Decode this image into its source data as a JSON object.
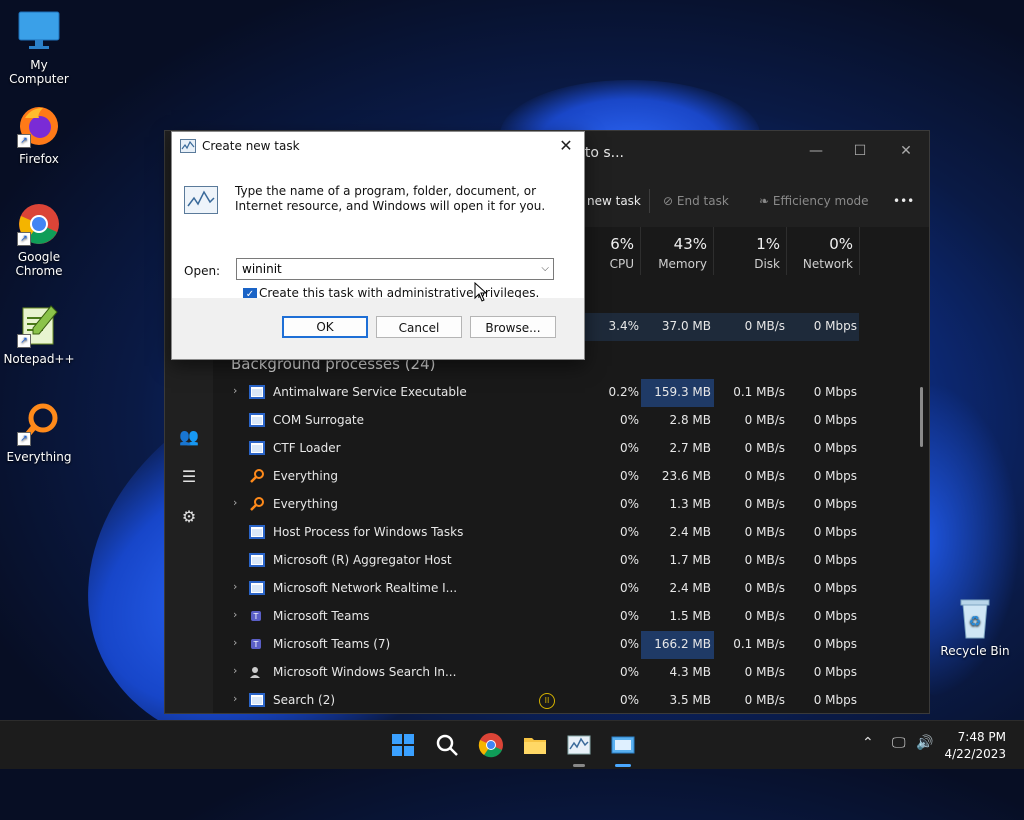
{
  "desktop": {
    "icons": [
      {
        "label": "My Computer",
        "icon": "monitor-icon"
      },
      {
        "label": "Firefox",
        "icon": "firefox-icon"
      },
      {
        "label": "Google Chrome",
        "icon": "chrome-icon"
      },
      {
        "label": "Notepad++",
        "icon": "notepadpp-icon"
      },
      {
        "label": "Everything",
        "icon": "everything-icon"
      },
      {
        "label": "Recycle Bin",
        "icon": "recycle-bin-icon"
      }
    ]
  },
  "task_manager": {
    "search_placeholder": "er, or PID to s...",
    "toolbar": {
      "new_task": "new task",
      "end_task": "End task",
      "efficiency_mode": "Efficiency mode",
      "more": "•••"
    },
    "columns": [
      {
        "pct": "6%",
        "name": "CPU"
      },
      {
        "pct": "43%",
        "name": "Memory"
      },
      {
        "pct": "1%",
        "name": "Disk"
      },
      {
        "pct": "0%",
        "name": "Network"
      }
    ],
    "top_row": {
      "cpu": "3.4%",
      "mem": "37.0 MB",
      "disk": "0 MB/s",
      "net": "0 Mbps"
    },
    "section_title": "Background processes (24)",
    "processes": [
      {
        "name": "Antimalware Service Executable",
        "expand": true,
        "cpu": "0.2%",
        "mem": "159.3 MB",
        "disk": "0.1 MB/s",
        "net": "0 Mbps"
      },
      {
        "name": "COM Surrogate",
        "expand": false,
        "cpu": "0%",
        "mem": "2.8 MB",
        "disk": "0 MB/s",
        "net": "0 Mbps"
      },
      {
        "name": "CTF Loader",
        "expand": false,
        "cpu": "0%",
        "mem": "2.7 MB",
        "disk": "0 MB/s",
        "net": "0 Mbps"
      },
      {
        "name": "Everything",
        "expand": false,
        "cpu": "0%",
        "mem": "23.6 MB",
        "disk": "0 MB/s",
        "net": "0 Mbps"
      },
      {
        "name": "Everything",
        "expand": true,
        "cpu": "0%",
        "mem": "1.3 MB",
        "disk": "0 MB/s",
        "net": "0 Mbps"
      },
      {
        "name": "Host Process for Windows Tasks",
        "expand": false,
        "cpu": "0%",
        "mem": "2.4 MB",
        "disk": "0 MB/s",
        "net": "0 Mbps"
      },
      {
        "name": "Microsoft (R) Aggregator Host",
        "expand": false,
        "cpu": "0%",
        "mem": "1.7 MB",
        "disk": "0 MB/s",
        "net": "0 Mbps"
      },
      {
        "name": "Microsoft Network Realtime I...",
        "expand": true,
        "cpu": "0%",
        "mem": "2.4 MB",
        "disk": "0 MB/s",
        "net": "0 Mbps"
      },
      {
        "name": "Microsoft Teams",
        "expand": true,
        "cpu": "0%",
        "mem": "1.5 MB",
        "disk": "0 MB/s",
        "net": "0 Mbps"
      },
      {
        "name": "Microsoft Teams (7)",
        "expand": true,
        "cpu": "0%",
        "mem": "166.2 MB",
        "disk": "0.1 MB/s",
        "net": "0 Mbps"
      },
      {
        "name": "Microsoft Windows Search In...",
        "expand": true,
        "cpu": "0%",
        "mem": "4.3 MB",
        "disk": "0 MB/s",
        "net": "0 Mbps"
      },
      {
        "name": "Search (2)",
        "expand": true,
        "cpu": "0%",
        "mem": "3.5 MB",
        "disk": "0 MB/s",
        "net": "0 Mbps"
      }
    ]
  },
  "dialog": {
    "title": "Create new task",
    "description": "Type the name of a program, folder, document, or Internet resource, and Windows will open it for you.",
    "open_label": "Open:",
    "open_value": "wininit",
    "admin_label": "Create this task with administrative privileges.",
    "admin_checked": true,
    "ok": "OK",
    "cancel": "Cancel",
    "browse": "Browse..."
  },
  "taskbar": {
    "time": "7:48 PM",
    "date": "4/22/2023"
  }
}
